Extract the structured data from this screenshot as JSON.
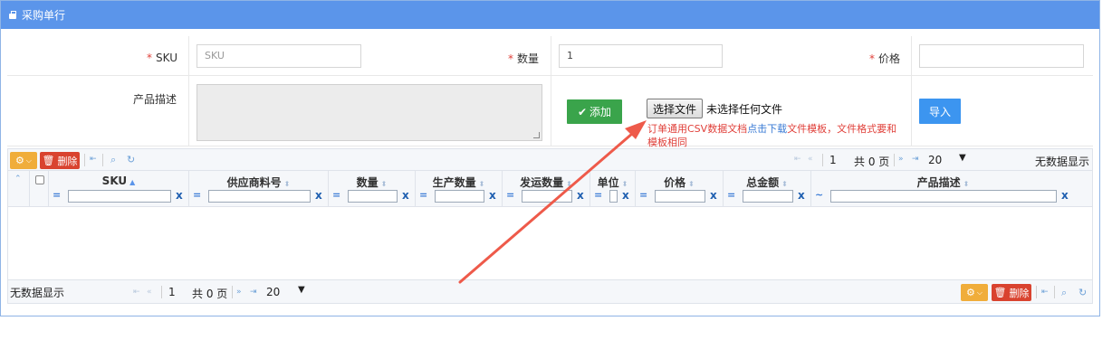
{
  "header": {
    "title": "采购单行",
    "icon": "briefcase-icon"
  },
  "form": {
    "sku_label": "SKU",
    "sku_placeholder": "SKU",
    "qty_label": "数量",
    "qty_value": "1",
    "price_label": "价格",
    "price_value": "",
    "desc_label": "产品描述",
    "add_button": "添加",
    "file_button": "选择文件",
    "file_none": "未选择任何文件",
    "hint_part1": "订单通用CSV数据文档",
    "hint_link": "点击下载",
    "hint_part2": "文件模板，文件格式要和模板相同",
    "import_button": "导入"
  },
  "grid": {
    "delete_label": "删除",
    "top_page": "1",
    "top_total": "共 0 页",
    "top_size": "20",
    "top_empty": "无数据显示",
    "columns": [
      {
        "label": "SKU",
        "op": "="
      },
      {
        "label": "供应商料号",
        "op": "="
      },
      {
        "label": "数量",
        "op": "="
      },
      {
        "label": "生产数量",
        "op": "="
      },
      {
        "label": "发运数量",
        "op": "="
      },
      {
        "label": "单位",
        "op": "="
      },
      {
        "label": "价格",
        "op": "="
      },
      {
        "label": "总金额",
        "op": "="
      },
      {
        "label": "产品描述",
        "op": "~"
      }
    ],
    "clear_label": "x",
    "bottom_empty": "无数据显示",
    "bottom_page": "1",
    "bottom_total": "共 0 页",
    "bottom_size": "20"
  },
  "colors": {
    "header_bg": "#5b95ea",
    "add_button": "#3aa44b",
    "import_button": "#3c95f0",
    "delete_button": "#d9432f",
    "gear_button": "#f0ad3a",
    "required_mark": "#e0403a",
    "arrow": "#ee5a4a"
  }
}
